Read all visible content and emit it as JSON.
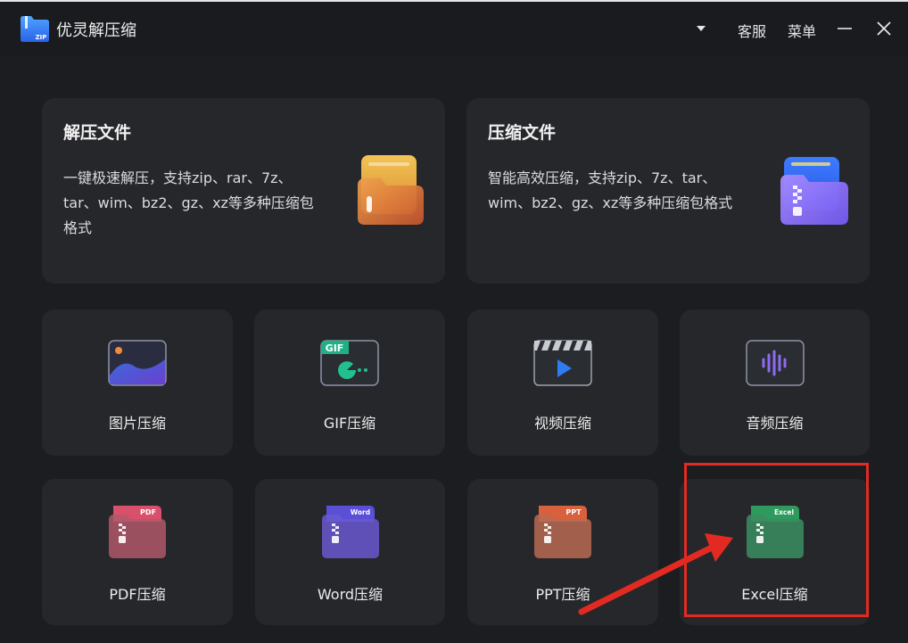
{
  "window": {
    "title": "优灵解压缩",
    "customer_service": "客服",
    "menu": "菜单"
  },
  "features": {
    "extract": {
      "title": "解压文件",
      "description": "一键极速解压，支持zip、rar、7z、tar、wim、bz2、gz、xz等多种压缩包格式"
    },
    "compress": {
      "title": "压缩文件",
      "description": "智能高效压缩，支持zip、7z、tar、wim、bz2、gz、xz等多种压缩包格式"
    }
  },
  "tools": [
    {
      "label": "图片压缩",
      "icon": "image-icon"
    },
    {
      "label": "GIF压缩",
      "icon": "gif-icon",
      "badge": "GIF"
    },
    {
      "label": "视频压缩",
      "icon": "video-icon"
    },
    {
      "label": "音频压缩",
      "icon": "audio-icon"
    },
    {
      "label": "PDF压缩",
      "icon": "pdf-zip-icon",
      "badge": "PDF"
    },
    {
      "label": "Word压缩",
      "icon": "word-zip-icon",
      "badge": "Word"
    },
    {
      "label": "PPT压缩",
      "icon": "ppt-zip-icon",
      "badge": "PPT"
    },
    {
      "label": "Excel压缩",
      "icon": "excel-zip-icon",
      "badge": "Excel"
    }
  ],
  "colors": {
    "background": "#1c1d20",
    "card": "#26272b",
    "highlight": "#e32a22",
    "pdf": "#d9506a",
    "word": "#5b4fd8",
    "ppt": "#d8603c",
    "excel": "#2f9a5e"
  }
}
